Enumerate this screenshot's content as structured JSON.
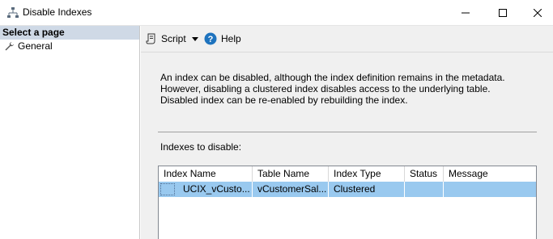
{
  "window": {
    "title": "Disable Indexes",
    "icon": "indexes-icon",
    "controls": [
      "minimize-icon",
      "maximize-icon",
      "close-icon"
    ]
  },
  "sidebar": {
    "header": "Select a page",
    "items": [
      {
        "label": "General",
        "icon": "wrench-icon"
      }
    ]
  },
  "toolbar": {
    "script_label": "Script",
    "help_label": "Help"
  },
  "description": "An index can be disabled, although the index definition remains in the metadata. However, disabling a clustered index disables access to the underlying table. Disabled index can be re-enabled by rebuilding the index.",
  "indexes_label": "Indexes to disable:",
  "grid": {
    "columns": [
      "Index Name",
      "Table Name",
      "Index Type",
      "Status",
      "Message"
    ],
    "rows": [
      [
        "UCIX_vCusto...",
        "vCustomerSal...",
        "Clustered",
        "",
        ""
      ]
    ]
  },
  "colors": {
    "selected_row": "#99c9ef",
    "sidebar_header": "#cfd9e6",
    "help_icon": "#1e73be"
  }
}
